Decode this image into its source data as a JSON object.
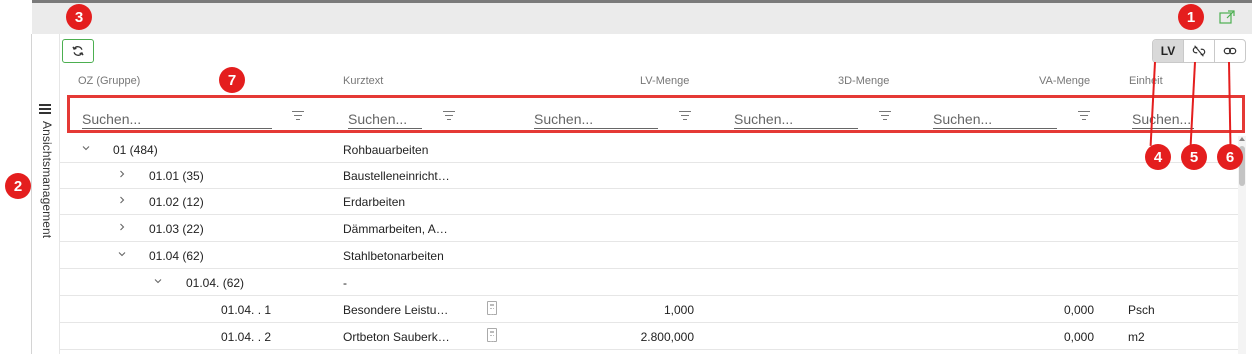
{
  "toolbar": {
    "mode_label": "LV"
  },
  "side_panel": {
    "label": "Ansichtsmanagement"
  },
  "columns": [
    {
      "label": "OZ (Gruppe)"
    },
    {
      "label": "Kurztext"
    },
    {
      "label": "LV-Menge"
    },
    {
      "label": "3D-Menge"
    },
    {
      "label": "VA-Menge"
    },
    {
      "label": "Einheit"
    }
  ],
  "filters": {
    "placeholder": "Suchen..."
  },
  "rows": [
    {
      "oz": "01 (484)",
      "kurztext": "Rohbauarbeiten",
      "lv_menge": "",
      "va_menge": "",
      "einheit": ""
    },
    {
      "oz": "01.01 (35)",
      "kurztext": "Baustelleneinricht…",
      "lv_menge": "",
      "va_menge": "",
      "einheit": ""
    },
    {
      "oz": "01.02 (12)",
      "kurztext": "Erdarbeiten",
      "lv_menge": "",
      "va_menge": "",
      "einheit": ""
    },
    {
      "oz": "01.03 (22)",
      "kurztext": "Dämmarbeiten, A…",
      "lv_menge": "",
      "va_menge": "",
      "einheit": ""
    },
    {
      "oz": "01.04 (62)",
      "kurztext": "Stahlbetonarbeiten",
      "lv_menge": "",
      "va_menge": "",
      "einheit": ""
    },
    {
      "oz": "01.04. (62)",
      "kurztext": "-",
      "lv_menge": "",
      "va_menge": "",
      "einheit": ""
    },
    {
      "oz": "01.04. . 1",
      "kurztext": "Besondere Leistu…",
      "lv_menge": "1,000",
      "va_menge": "0,000",
      "einheit": "Psch"
    },
    {
      "oz": "01.04. . 2",
      "kurztext": "Ortbeton Sauberk…",
      "lv_menge": "2.800,000",
      "va_menge": "0,000",
      "einheit": "m2"
    }
  ],
  "annotations": {
    "b1": "1",
    "b2": "2",
    "b3": "3",
    "b4": "4",
    "b5": "5",
    "b6": "6",
    "b7": "7"
  },
  "colors": {
    "accent_green": "#4caf50",
    "annotation_red": "#e41e1e"
  },
  "icons": {
    "refresh": "refresh-icon",
    "popout": "external-window-icon",
    "unlink": "unlink-icon",
    "link": "link-icon",
    "filter": "filter-icon",
    "menu": "hamburger-icon",
    "calc": "calculator-icon"
  }
}
